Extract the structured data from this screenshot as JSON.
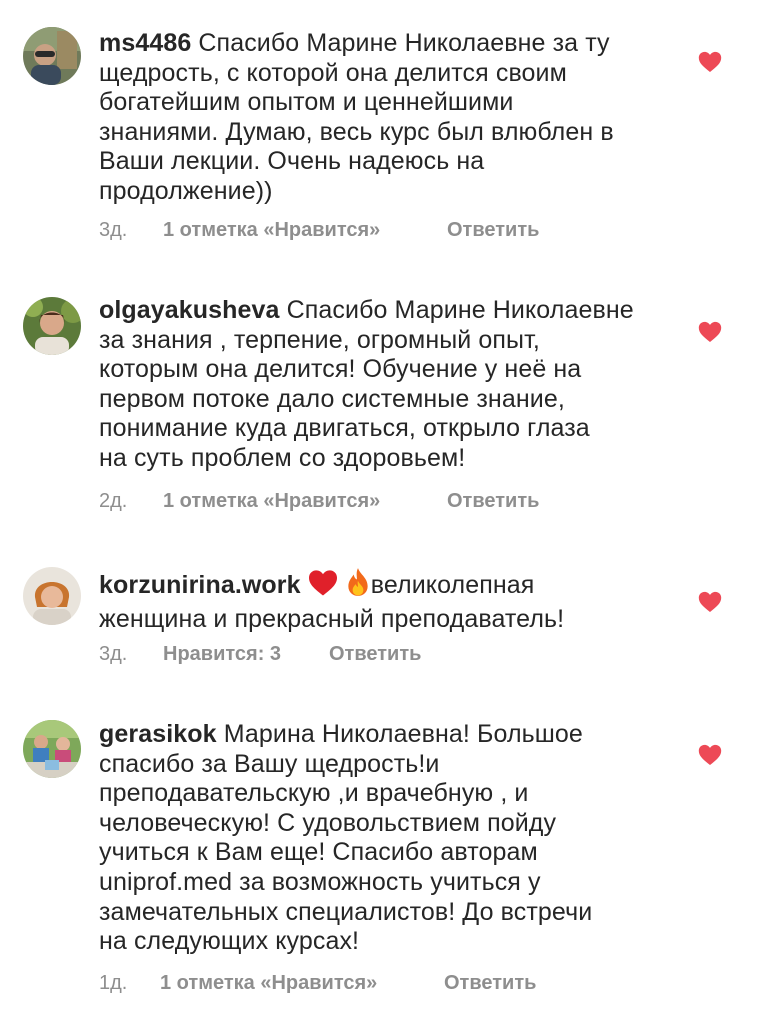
{
  "colors": {
    "text": "#262626",
    "meta": "#8e8e8e",
    "like": "#ed4956",
    "background": "#ffffff"
  },
  "comments": [
    {
      "username": "ms4486",
      "lines": [
        "Спасибо Марине Николаевне за ту",
        "щедрость, с которой она делится своим",
        "богатейшим опытом и ценнейшими",
        "знаниями. Думаю, весь курс был влюблен в",
        "Ваши лекции.  Очень надеюсь на",
        "продолжение))"
      ],
      "time": "3д.",
      "likes": "1 отметка «Нравится»",
      "reply": "Ответить",
      "avatar_icon": "avatar-photo-icon"
    },
    {
      "username": "olgayakusheva",
      "lines": [
        "Спасибо Марине Николаевне",
        "за знания , терпение, огромный опыт,",
        "которым она делится! Обучение у неё на",
        "первом потоке дало системные знание,",
        "понимание куда двигаться, открыло глаза",
        "на суть проблем со здоровьем!"
      ],
      "time": "2д.",
      "likes": "1 отметка «Нравится»",
      "reply": "Ответить",
      "avatar_icon": "avatar-photo-icon"
    },
    {
      "username": "korzunirina.work",
      "lines": [
        "великолепная",
        "женщина и прекрасный преподаватель!"
      ],
      "emoji": [
        "red-heart-icon",
        "fire-icon"
      ],
      "time": "3д.",
      "likes": "Нравится: 3",
      "reply": "Ответить",
      "avatar_icon": "avatar-photo-icon"
    },
    {
      "username": "gerasikok",
      "lines": [
        "Марина Николаевна! Большое",
        "спасибо за Вашу щедрость!и",
        "преподавательскую ,и врачебную , и",
        "человеческую! С удовольствием пойду",
        "учиться к Вам еще! Спасибо авторам",
        "uniprof.med за возможность учиться у",
        "замечательных специалистов! До встречи",
        "на следующих курсах!"
      ],
      "time": "1д.",
      "likes": "1 отметка «Нравится»",
      "reply": "Ответить",
      "avatar_icon": "avatar-photo-icon"
    }
  ]
}
